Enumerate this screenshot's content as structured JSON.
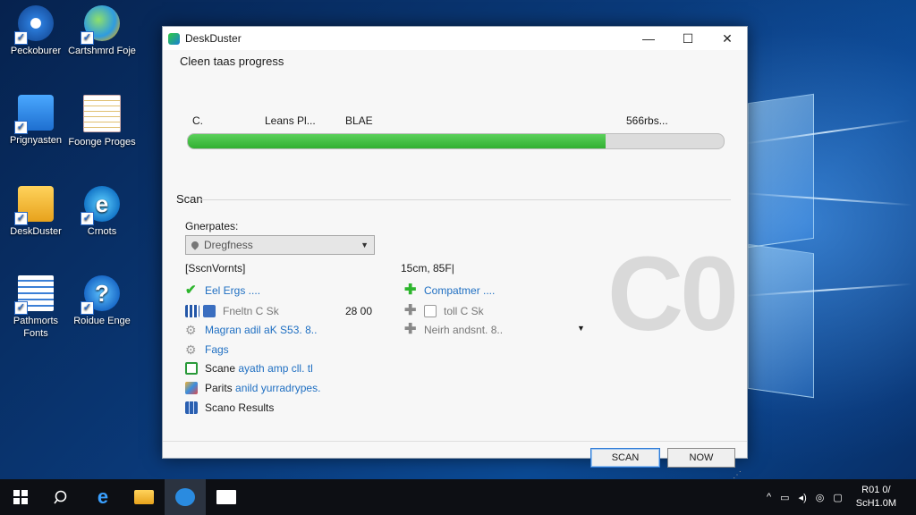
{
  "desktop": {
    "icons": [
      {
        "label": "Peckoburer",
        "icon": "blue-disc-icon"
      },
      {
        "label": "Cartshmrd Foje",
        "icon": "globe-icon"
      },
      {
        "label": "Prignyasten",
        "icon": "document-blue-icon"
      },
      {
        "label": "Foonge Proges",
        "icon": "notepad-icon"
      },
      {
        "label": "DeskDuster",
        "icon": "folder-icon"
      },
      {
        "label": "Crnots",
        "icon": "browser-e-icon"
      },
      {
        "label": "Pathmorts Fonts",
        "icon": "document-lines-icon"
      },
      {
        "label": "Roidue Enge",
        "icon": "help-icon"
      }
    ]
  },
  "window": {
    "title": "DeskDuster",
    "heading": "Cleen taas progress",
    "progress": {
      "labels": [
        "C.",
        "Leans Pl...",
        "BLAE",
        "566rbs..."
      ],
      "fraction": 0.78,
      "color": "#3cbc3c"
    },
    "section": "Scan",
    "field_label": "Gnerpates:",
    "select_value": "Dregfness",
    "col_left_header": "SscnVornts",
    "col_right_header": "15cm, 85F",
    "left_items": [
      {
        "text": "Eel Ergs ....",
        "icon": "green-check-icon",
        "style": "link"
      },
      {
        "text": "Fneltn C Sk",
        "icon": "grid-icon",
        "style": "muted"
      },
      {
        "text": "Magran adil aK S53. 8..",
        "icon": "gear-icon",
        "style": "link"
      },
      {
        "text": "Fags",
        "icon": "gear-icon",
        "style": "link"
      },
      {
        "text": "Scane",
        "extra": "ayath amp cll. tl",
        "icon": "image-icon",
        "style": "mixed"
      },
      {
        "text": "Parits",
        "extra": "anild yurradrypes.",
        "icon": "paint-icon",
        "style": "mixed"
      },
      {
        "text": "Scano Results",
        "icon": "table-icon",
        "style": "plain"
      }
    ],
    "middle_value": "28 00",
    "right_items": [
      {
        "text": "Compatmer ....",
        "icon": "green-plus-icon",
        "style": "link"
      },
      {
        "text": "toll C Sk",
        "icon": "plus-icon",
        "style": "muted"
      },
      {
        "text": "Neirh andsnt. 8..",
        "icon": "plus-icon",
        "style": "muted"
      }
    ],
    "watermark": "C0",
    "buttons": {
      "scan": "SCAN",
      "now": "NOW"
    }
  },
  "taskbar": {
    "clock_time": "R01 0/",
    "clock_date": "ScH1.0M"
  }
}
